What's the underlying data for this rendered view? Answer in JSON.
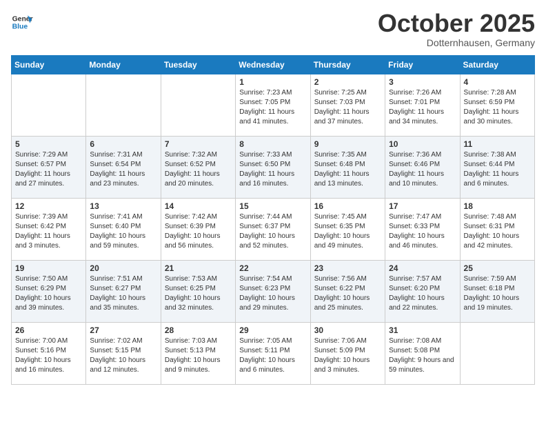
{
  "logo": {
    "text_general": "General",
    "text_blue": "Blue"
  },
  "header": {
    "title": "October 2025",
    "subtitle": "Dotternhausen, Germany"
  },
  "weekdays": [
    "Sunday",
    "Monday",
    "Tuesday",
    "Wednesday",
    "Thursday",
    "Friday",
    "Saturday"
  ],
  "weeks": [
    [
      {
        "day": "",
        "sunrise": "",
        "sunset": "",
        "daylight": ""
      },
      {
        "day": "",
        "sunrise": "",
        "sunset": "",
        "daylight": ""
      },
      {
        "day": "",
        "sunrise": "",
        "sunset": "",
        "daylight": ""
      },
      {
        "day": "1",
        "sunrise": "Sunrise: 7:23 AM",
        "sunset": "Sunset: 7:05 PM",
        "daylight": "Daylight: 11 hours and 41 minutes."
      },
      {
        "day": "2",
        "sunrise": "Sunrise: 7:25 AM",
        "sunset": "Sunset: 7:03 PM",
        "daylight": "Daylight: 11 hours and 37 minutes."
      },
      {
        "day": "3",
        "sunrise": "Sunrise: 7:26 AM",
        "sunset": "Sunset: 7:01 PM",
        "daylight": "Daylight: 11 hours and 34 minutes."
      },
      {
        "day": "4",
        "sunrise": "Sunrise: 7:28 AM",
        "sunset": "Sunset: 6:59 PM",
        "daylight": "Daylight: 11 hours and 30 minutes."
      }
    ],
    [
      {
        "day": "5",
        "sunrise": "Sunrise: 7:29 AM",
        "sunset": "Sunset: 6:57 PM",
        "daylight": "Daylight: 11 hours and 27 minutes."
      },
      {
        "day": "6",
        "sunrise": "Sunrise: 7:31 AM",
        "sunset": "Sunset: 6:54 PM",
        "daylight": "Daylight: 11 hours and 23 minutes."
      },
      {
        "day": "7",
        "sunrise": "Sunrise: 7:32 AM",
        "sunset": "Sunset: 6:52 PM",
        "daylight": "Daylight: 11 hours and 20 minutes."
      },
      {
        "day": "8",
        "sunrise": "Sunrise: 7:33 AM",
        "sunset": "Sunset: 6:50 PM",
        "daylight": "Daylight: 11 hours and 16 minutes."
      },
      {
        "day": "9",
        "sunrise": "Sunrise: 7:35 AM",
        "sunset": "Sunset: 6:48 PM",
        "daylight": "Daylight: 11 hours and 13 minutes."
      },
      {
        "day": "10",
        "sunrise": "Sunrise: 7:36 AM",
        "sunset": "Sunset: 6:46 PM",
        "daylight": "Daylight: 11 hours and 10 minutes."
      },
      {
        "day": "11",
        "sunrise": "Sunrise: 7:38 AM",
        "sunset": "Sunset: 6:44 PM",
        "daylight": "Daylight: 11 hours and 6 minutes."
      }
    ],
    [
      {
        "day": "12",
        "sunrise": "Sunrise: 7:39 AM",
        "sunset": "Sunset: 6:42 PM",
        "daylight": "Daylight: 11 hours and 3 minutes."
      },
      {
        "day": "13",
        "sunrise": "Sunrise: 7:41 AM",
        "sunset": "Sunset: 6:40 PM",
        "daylight": "Daylight: 10 hours and 59 minutes."
      },
      {
        "day": "14",
        "sunrise": "Sunrise: 7:42 AM",
        "sunset": "Sunset: 6:39 PM",
        "daylight": "Daylight: 10 hours and 56 minutes."
      },
      {
        "day": "15",
        "sunrise": "Sunrise: 7:44 AM",
        "sunset": "Sunset: 6:37 PM",
        "daylight": "Daylight: 10 hours and 52 minutes."
      },
      {
        "day": "16",
        "sunrise": "Sunrise: 7:45 AM",
        "sunset": "Sunset: 6:35 PM",
        "daylight": "Daylight: 10 hours and 49 minutes."
      },
      {
        "day": "17",
        "sunrise": "Sunrise: 7:47 AM",
        "sunset": "Sunset: 6:33 PM",
        "daylight": "Daylight: 10 hours and 46 minutes."
      },
      {
        "day": "18",
        "sunrise": "Sunrise: 7:48 AM",
        "sunset": "Sunset: 6:31 PM",
        "daylight": "Daylight: 10 hours and 42 minutes."
      }
    ],
    [
      {
        "day": "19",
        "sunrise": "Sunrise: 7:50 AM",
        "sunset": "Sunset: 6:29 PM",
        "daylight": "Daylight: 10 hours and 39 minutes."
      },
      {
        "day": "20",
        "sunrise": "Sunrise: 7:51 AM",
        "sunset": "Sunset: 6:27 PM",
        "daylight": "Daylight: 10 hours and 35 minutes."
      },
      {
        "day": "21",
        "sunrise": "Sunrise: 7:53 AM",
        "sunset": "Sunset: 6:25 PM",
        "daylight": "Daylight: 10 hours and 32 minutes."
      },
      {
        "day": "22",
        "sunrise": "Sunrise: 7:54 AM",
        "sunset": "Sunset: 6:23 PM",
        "daylight": "Daylight: 10 hours and 29 minutes."
      },
      {
        "day": "23",
        "sunrise": "Sunrise: 7:56 AM",
        "sunset": "Sunset: 6:22 PM",
        "daylight": "Daylight: 10 hours and 25 minutes."
      },
      {
        "day": "24",
        "sunrise": "Sunrise: 7:57 AM",
        "sunset": "Sunset: 6:20 PM",
        "daylight": "Daylight: 10 hours and 22 minutes."
      },
      {
        "day": "25",
        "sunrise": "Sunrise: 7:59 AM",
        "sunset": "Sunset: 6:18 PM",
        "daylight": "Daylight: 10 hours and 19 minutes."
      }
    ],
    [
      {
        "day": "26",
        "sunrise": "Sunrise: 7:00 AM",
        "sunset": "Sunset: 5:16 PM",
        "daylight": "Daylight: 10 hours and 16 minutes."
      },
      {
        "day": "27",
        "sunrise": "Sunrise: 7:02 AM",
        "sunset": "Sunset: 5:15 PM",
        "daylight": "Daylight: 10 hours and 12 minutes."
      },
      {
        "day": "28",
        "sunrise": "Sunrise: 7:03 AM",
        "sunset": "Sunset: 5:13 PM",
        "daylight": "Daylight: 10 hours and 9 minutes."
      },
      {
        "day": "29",
        "sunrise": "Sunrise: 7:05 AM",
        "sunset": "Sunset: 5:11 PM",
        "daylight": "Daylight: 10 hours and 6 minutes."
      },
      {
        "day": "30",
        "sunrise": "Sunrise: 7:06 AM",
        "sunset": "Sunset: 5:09 PM",
        "daylight": "Daylight: 10 hours and 3 minutes."
      },
      {
        "day": "31",
        "sunrise": "Sunrise: 7:08 AM",
        "sunset": "Sunset: 5:08 PM",
        "daylight": "Daylight: 9 hours and 59 minutes."
      },
      {
        "day": "",
        "sunrise": "",
        "sunset": "",
        "daylight": ""
      }
    ]
  ]
}
